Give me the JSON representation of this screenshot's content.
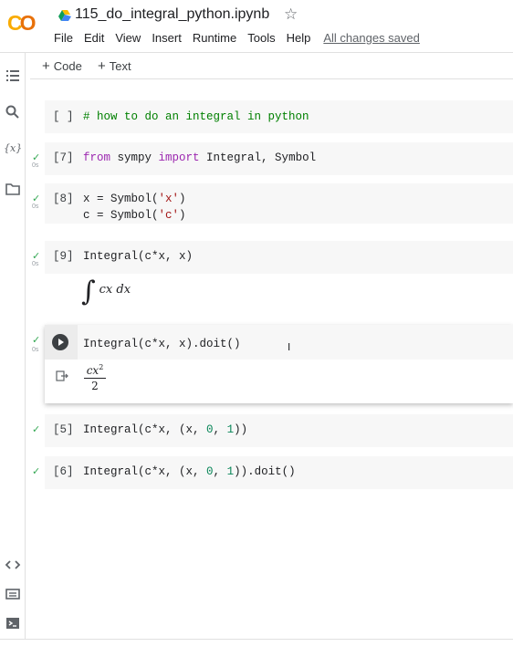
{
  "app": {
    "logo_text_c": "C",
    "logo_text_o": "O",
    "title": "115_do_integral_python.ipynb"
  },
  "menu": [
    "File",
    "Edit",
    "View",
    "Insert",
    "Runtime",
    "Tools",
    "Help"
  ],
  "saved_status": "All changes saved",
  "toolbar": {
    "code_label": "Code",
    "text_label": "Text",
    "plus": "+"
  },
  "rail_icons": [
    "table-of-contents-icon",
    "search-icon",
    "variables-icon",
    "folder-icon",
    "code-snippets-icon",
    "command-palette-icon",
    "terminal-icon"
  ],
  "rail_variables_text": "{x}",
  "cells": {
    "c0": {
      "count": "[ ]",
      "comment": "# how to do an integral in python"
    },
    "c1": {
      "count": "[7]",
      "kw_from": "from",
      "mod": " sympy ",
      "kw_import": "import",
      "rest": " Integral, Symbol",
      "time": "0s"
    },
    "c2": {
      "count": "[8]",
      "l1a": "x = Symbol(",
      "l1s": "'x'",
      "l1b": ")",
      "l2a": "c = Symbol(",
      "l2s": "'c'",
      "l2b": ")",
      "time": "0s"
    },
    "c3": {
      "count": "[9]",
      "code": "Integral(c*x, x)",
      "time": "0s",
      "out_integral": "∫",
      "out_expr": "cx dx"
    },
    "c4": {
      "code": "Integral(c*x, x).doit()",
      "time": "0s",
      "out_num": "cx",
      "out_exp": "2",
      "out_den": "2"
    },
    "c5": {
      "count": "[5]",
      "pre": "Integral(c*x, (x, ",
      "n0": "0",
      "mid": ", ",
      "n1": "1",
      "post": "))"
    },
    "c6": {
      "count": "[6]",
      "pre": "Integral(c*x, (x, ",
      "n0": "0",
      "mid": ", ",
      "n1": "1",
      "post": ")).doit()"
    }
  },
  "check_mark": "✓",
  "colors": {
    "accent_orange": "#e8710a",
    "accent_yellow": "#f9ab00",
    "check_green": "#34a853",
    "keyword_purple": "#9c27b0",
    "comment_green": "#008000",
    "string_red": "#a31515",
    "number_green": "#098658"
  }
}
